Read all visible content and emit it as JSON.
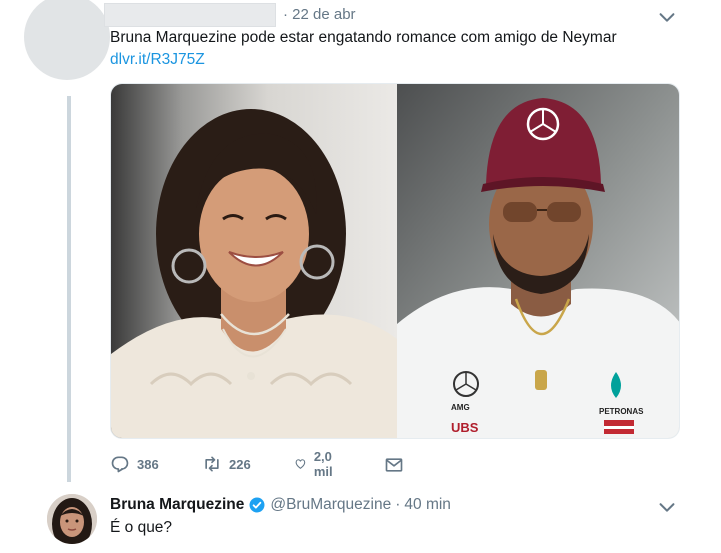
{
  "tweet": {
    "date": "· 22 de abr",
    "text": "Bruna Marquezine pode estar engatando romance com amigo de Neymar",
    "link": "dlvr.it/R3J75Z",
    "stats": {
      "replies": "386",
      "retweets": "226",
      "likes": "2,0 mil"
    }
  },
  "reply": {
    "name": "Bruna Marquezine",
    "handle": "@BruMarquezine",
    "dot": "·",
    "time": "40 min",
    "text": "É o que?"
  },
  "colors": {
    "link": "#1b95e0",
    "muted": "#657786",
    "thread": "#ccd6dd",
    "verified": "#1da1f2"
  },
  "icons": [
    "chevron-down-icon",
    "reply-icon",
    "retweet-icon",
    "like-icon",
    "message-icon",
    "verified-badge-icon"
  ]
}
